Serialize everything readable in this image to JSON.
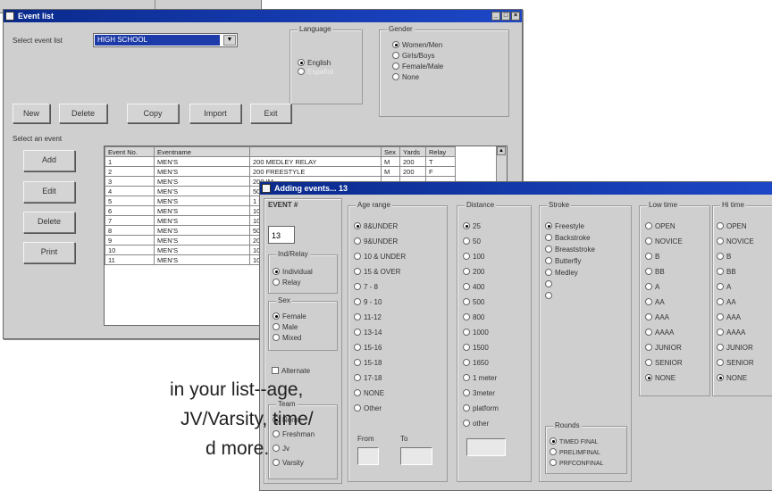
{
  "bg_window": {
    "title": ""
  },
  "event_list": {
    "title": "Event list",
    "select_event_list_label": "Select event list",
    "event_list_value": "HIGH SCHOOL",
    "language": {
      "title": "Language",
      "options": [
        {
          "label": "English",
          "selected": true
        },
        {
          "label": "Español",
          "selected": false
        }
      ]
    },
    "gender": {
      "title": "Gender",
      "options": [
        {
          "label": "Women/Men",
          "selected": true
        },
        {
          "label": "Girls/Boys",
          "selected": false
        },
        {
          "label": "Female/Male",
          "selected": false
        },
        {
          "label": "None",
          "selected": false
        }
      ]
    },
    "buttons": {
      "new": "New",
      "delete": "Delete",
      "copy": "Copy",
      "import": "Import",
      "exit": "Exit"
    },
    "select_event_label": "Select an event",
    "side_buttons": {
      "add": "Add",
      "edit": "Edit",
      "delete": "Delete",
      "print": "Print"
    },
    "table": {
      "headers": [
        "Event No.",
        "Eventname",
        "",
        "Sex",
        "Yards",
        "Relay"
      ],
      "rows": [
        [
          "1",
          "MEN'S",
          "200 MEDLEY RELAY",
          "M",
          "200",
          "T"
        ],
        [
          "2",
          "MEN'S",
          "200 FREESTYLE",
          "M",
          "200",
          "F"
        ],
        [
          "3",
          "MEN'S",
          "200 IM",
          "",
          "",
          ""
        ],
        [
          "4",
          "MEN'S",
          "50 FREEST",
          "",
          "",
          ""
        ],
        [
          "5",
          "MEN'S",
          "1 METER I",
          "",
          "",
          ""
        ],
        [
          "6",
          "MEN'S",
          "100 BUTTE",
          "",
          "",
          ""
        ],
        [
          "7",
          "MEN'S",
          "100 FREES",
          "",
          "",
          ""
        ],
        [
          "8",
          "MEN'S",
          "500 FREES",
          "",
          "",
          ""
        ],
        [
          "9",
          "MEN'S",
          "200 FREES",
          "",
          "",
          ""
        ],
        [
          "10",
          "MEN'S",
          "100 BACKS",
          "",
          "",
          ""
        ],
        [
          "11",
          "MEN'S",
          "100 BREAS",
          "",
          "",
          ""
        ]
      ]
    }
  },
  "adding_events": {
    "title": "Adding events... 13",
    "event_num_label": "EVENT #",
    "event_num_value": "13",
    "ind_relay": {
      "title": "Ind/Relay",
      "options": [
        {
          "label": "Individual",
          "selected": true
        },
        {
          "label": "Relay",
          "selected": false
        }
      ]
    },
    "sex": {
      "title": "Sex",
      "options": [
        {
          "label": "Female",
          "selected": true
        },
        {
          "label": "Male",
          "selected": false
        },
        {
          "label": "Mixed",
          "selected": false
        }
      ]
    },
    "alternate_label": "Alternate",
    "team": {
      "title": "Team",
      "options": [
        {
          "label": "None",
          "selected": true
        },
        {
          "label": "Freshman",
          "selected": false
        },
        {
          "label": "Jv",
          "selected": false
        },
        {
          "label": "Varsity",
          "selected": false
        }
      ]
    },
    "age_range": {
      "title": "Age range",
      "options": [
        {
          "label": "8&UNDER",
          "selected": true
        },
        {
          "label": "9&UNDER",
          "selected": false
        },
        {
          "label": "10 & UNDER",
          "selected": false
        },
        {
          "label": "15 & OVER",
          "selected": false
        },
        {
          "label": "7 - 8",
          "selected": false
        },
        {
          "label": "9 - 10",
          "selected": false
        },
        {
          "label": "11-12",
          "selected": false
        },
        {
          "label": "13-14",
          "selected": false
        },
        {
          "label": "15-16",
          "selected": false
        },
        {
          "label": "15-18",
          "selected": false
        },
        {
          "label": "17-18",
          "selected": false
        },
        {
          "label": "NONE",
          "selected": false
        },
        {
          "label": "Other",
          "selected": false
        }
      ]
    },
    "from_label": "From",
    "to_label": "To",
    "distance": {
      "title": "Distance",
      "options": [
        {
          "label": "25",
          "selected": true
        },
        {
          "label": "50",
          "selected": false
        },
        {
          "label": "100",
          "selected": false
        },
        {
          "label": "200",
          "selected": false
        },
        {
          "label": "400",
          "selected": false
        },
        {
          "label": "500",
          "selected": false
        },
        {
          "label": "800",
          "selected": false
        },
        {
          "label": "1000",
          "selected": false
        },
        {
          "label": "1500",
          "selected": false
        },
        {
          "label": "1650",
          "selected": false
        },
        {
          "label": "1 meter",
          "selected": false
        },
        {
          "label": "3meter",
          "selected": false
        },
        {
          "label": "platform",
          "selected": false
        },
        {
          "label": "other",
          "selected": false
        }
      ]
    },
    "stroke": {
      "title": "Stroke",
      "options": [
        {
          "label": "Freestyle",
          "selected": true
        },
        {
          "label": "Backstroke",
          "selected": false
        },
        {
          "label": "Breaststroke",
          "selected": false
        },
        {
          "label": "Butterfly",
          "selected": false
        },
        {
          "label": "Medley",
          "selected": false
        },
        {
          "label": "",
          "selected": false
        },
        {
          "label": "",
          "selected": false
        }
      ]
    },
    "rounds": {
      "title": "Rounds",
      "options": [
        {
          "label": "TIMED FINAL",
          "selected": true
        },
        {
          "label": "PRELIMFINAL",
          "selected": false
        },
        {
          "label": "PRFCONFINAL",
          "selected": false
        }
      ]
    },
    "low_time": {
      "title": "Low time",
      "options": [
        {
          "label": "OPEN",
          "selected": false
        },
        {
          "label": "NOVICE",
          "selected": false
        },
        {
          "label": "B",
          "selected": false
        },
        {
          "label": "BB",
          "selected": false
        },
        {
          "label": "A",
          "selected": false
        },
        {
          "label": "AA",
          "selected": false
        },
        {
          "label": "AAA",
          "selected": false
        },
        {
          "label": "AAAA",
          "selected": false
        },
        {
          "label": "JUNIOR",
          "selected": false
        },
        {
          "label": "SENIOR",
          "selected": false
        },
        {
          "label": "NONE",
          "selected": true
        }
      ]
    },
    "hi_time": {
      "title": "Hi time",
      "options": [
        {
          "label": "OPEN",
          "selected": false
        },
        {
          "label": "NOVICE",
          "selected": false
        },
        {
          "label": "B",
          "selected": false
        },
        {
          "label": "BB",
          "selected": false
        },
        {
          "label": "A",
          "selected": false
        },
        {
          "label": "AA",
          "selected": false
        },
        {
          "label": "AAA",
          "selected": false
        },
        {
          "label": "AAAA",
          "selected": false
        },
        {
          "label": "JUNIOR",
          "selected": false
        },
        {
          "label": "SENIOR",
          "selected": false
        },
        {
          "label": "NONE",
          "selected": true
        }
      ]
    }
  },
  "caption": {
    "line1": "in your list--age,",
    "line2": "JV/Varsity, time/",
    "line3": "d more."
  }
}
